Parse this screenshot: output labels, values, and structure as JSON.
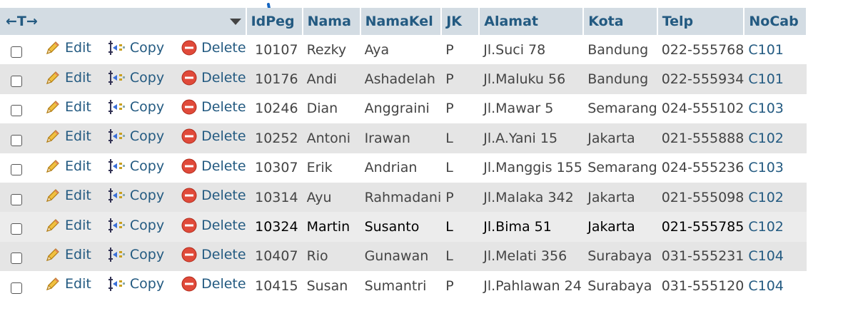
{
  "header": {
    "arrows": "←T→",
    "columns": [
      "IdPeg",
      "Nama",
      "NamaKel",
      "JK",
      "Alamat",
      "Kota",
      "Telp",
      "NoCab"
    ]
  },
  "actions": {
    "edit": "Edit",
    "copy": "Copy",
    "delete": "Delete"
  },
  "rows": [
    {
      "idpeg": "10107",
      "nama": "Rezky",
      "namakel": "Aya",
      "jk": "P",
      "alamat": "Jl.Suci 78",
      "kota": "Bandung",
      "telp": "022-555768",
      "nocab": "C101"
    },
    {
      "idpeg": "10176",
      "nama": "Andi",
      "namakel": "Ashadelah",
      "jk": "P",
      "alamat": "Jl.Maluku 56",
      "kota": "Bandung",
      "telp": "022-555934",
      "nocab": "C101"
    },
    {
      "idpeg": "10246",
      "nama": "Dian",
      "namakel": "Anggraini",
      "jk": "P",
      "alamat": "Jl.Mawar 5",
      "kota": "Semarang",
      "telp": "024-555102",
      "nocab": "C103"
    },
    {
      "idpeg": "10252",
      "nama": "Antoni",
      "namakel": "Irawan",
      "jk": "L",
      "alamat": "Jl.A.Yani 15",
      "kota": "Jakarta",
      "telp": "021-555888",
      "nocab": "C102"
    },
    {
      "idpeg": "10307",
      "nama": "Erik",
      "namakel": "Andrian",
      "jk": "L",
      "alamat": "Jl.Manggis 155",
      "kota": "Semarang",
      "telp": "024-555236",
      "nocab": "C103"
    },
    {
      "idpeg": "10314",
      "nama": "Ayu",
      "namakel": "Rahmadani",
      "jk": "P",
      "alamat": "Jl.Malaka 342",
      "kota": "Jakarta",
      "telp": "021-555098",
      "nocab": "C102"
    },
    {
      "idpeg": "10324",
      "nama": "Martin",
      "namakel": "Susanto",
      "jk": "L",
      "alamat": "Jl.Bima 51",
      "kota": "Jakarta",
      "telp": "021-555785",
      "nocab": "C102"
    },
    {
      "idpeg": "10407",
      "nama": "Rio",
      "namakel": "Gunawan",
      "jk": "L",
      "alamat": "Jl.Melati 356",
      "kota": "Surabaya",
      "telp": "031-555231",
      "nocab": "C104"
    },
    {
      "idpeg": "10415",
      "nama": "Susan",
      "namakel": "Sumantri",
      "jk": "P",
      "alamat": "Jl.Pahlawan 24",
      "kota": "Surabaya",
      "telp": "031-555120",
      "nocab": "C104"
    }
  ],
  "highlighted_row": 6,
  "colors": {
    "header_bg": "#d3dce3",
    "link": "#235a81",
    "even_row": "#e5e5e5",
    "pointer": "#1565c0"
  }
}
